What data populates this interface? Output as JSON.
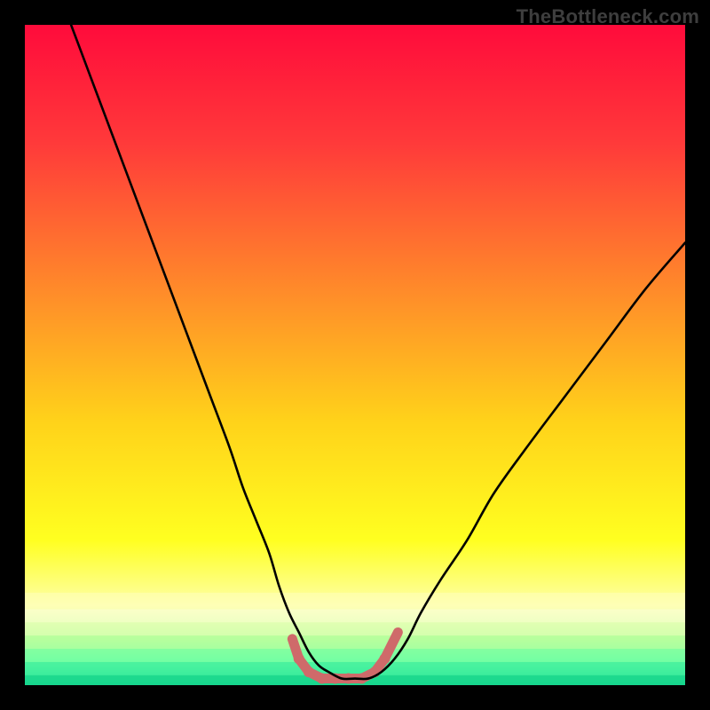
{
  "watermark": "TheBottleneck.com",
  "chart_data": {
    "type": "line",
    "title": "",
    "xlabel": "",
    "ylabel": "",
    "xlim": [
      0,
      100
    ],
    "ylim": [
      0,
      100
    ],
    "legend": false,
    "grid": false,
    "background_gradient": [
      {
        "stop": 0.0,
        "color": "#ff0b3b"
      },
      {
        "stop": 0.18,
        "color": "#ff3a3a"
      },
      {
        "stop": 0.4,
        "color": "#ff8a2a"
      },
      {
        "stop": 0.6,
        "color": "#ffd21a"
      },
      {
        "stop": 0.78,
        "color": "#ffff20"
      },
      {
        "stop": 0.88,
        "color": "#fdffa8"
      },
      {
        "stop": 0.93,
        "color": "#b9ff8a"
      },
      {
        "stop": 0.97,
        "color": "#5fff9d"
      },
      {
        "stop": 1.0,
        "color": "#1be08f"
      }
    ],
    "series": [
      {
        "name": "curve",
        "color": "#000000",
        "x": [
          7,
          10,
          13,
          16,
          19,
          22,
          25,
          28,
          31,
          33,
          35,
          37,
          38.5,
          40,
          41.5,
          43,
          44.5,
          46,
          48,
          50,
          52,
          54,
          56,
          58,
          60,
          63,
          67,
          71,
          76,
          82,
          88,
          94,
          100
        ],
        "y": [
          100,
          92,
          84,
          76,
          68,
          60,
          52,
          44,
          36,
          30,
          25,
          20,
          15,
          11,
          8,
          5,
          3,
          2,
          1,
          1,
          1,
          2,
          4,
          7,
          11,
          16,
          22,
          29,
          36,
          44,
          52,
          60,
          67
        ]
      }
    ],
    "valley_markers": {
      "color": "#cf6a6a",
      "radius_small": 4,
      "radius_large": 6,
      "points": [
        {
          "x": 40.5,
          "y": 7,
          "r": "small"
        },
        {
          "x": 41.5,
          "y": 4,
          "r": "large"
        },
        {
          "x": 43.0,
          "y": 2,
          "r": "large"
        },
        {
          "x": 45.0,
          "y": 1,
          "r": "large"
        },
        {
          "x": 47.0,
          "y": 1,
          "r": "large"
        },
        {
          "x": 49.0,
          "y": 1,
          "r": "large"
        },
        {
          "x": 51.0,
          "y": 1,
          "r": "large"
        },
        {
          "x": 53.0,
          "y": 2,
          "r": "large"
        },
        {
          "x": 54.5,
          "y": 4,
          "r": "large"
        },
        {
          "x": 55.5,
          "y": 6,
          "r": "small"
        },
        {
          "x": 56.5,
          "y": 8,
          "r": "small"
        }
      ]
    }
  }
}
